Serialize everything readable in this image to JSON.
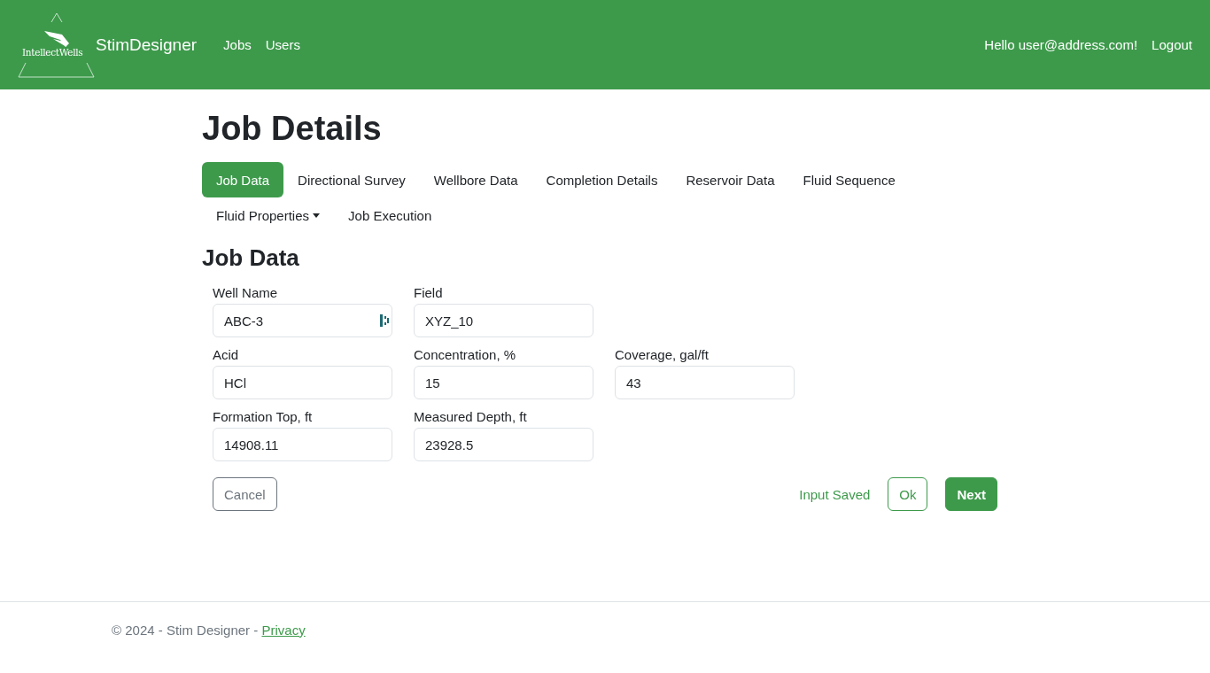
{
  "header": {
    "logo_text": "IntellectWells",
    "brand": "StimDesigner",
    "nav": [
      "Jobs",
      "Users"
    ],
    "greeting": "Hello user@address.com!",
    "logout": "Logout"
  },
  "page_title": "Job Details",
  "tabs": [
    {
      "label": "Job Data",
      "selected": true,
      "dropdown": false
    },
    {
      "label": "Directional Survey",
      "selected": false,
      "dropdown": false
    },
    {
      "label": "Wellbore Data",
      "selected": false,
      "dropdown": false
    },
    {
      "label": "Completion Details",
      "selected": false,
      "dropdown": false
    },
    {
      "label": "Reservoir Data",
      "selected": false,
      "dropdown": false
    },
    {
      "label": "Fluid Sequence",
      "selected": false,
      "dropdown": false
    },
    {
      "label": "Fluid Properties",
      "selected": false,
      "dropdown": true
    },
    {
      "label": "Job Execution",
      "selected": false,
      "dropdown": false
    }
  ],
  "section_title": "Job Data",
  "form_rows": [
    [
      {
        "label": "Well Name",
        "value": "ABC-3",
        "autofill_icon": true
      },
      {
        "label": "Field",
        "value": "XYZ_10",
        "autofill_icon": false
      }
    ],
    [
      {
        "label": "Acid",
        "value": "HCl",
        "autofill_icon": false
      },
      {
        "label": "Concentration, %",
        "value": "15",
        "autofill_icon": false
      },
      {
        "label": "Coverage, gal/ft",
        "value": "43",
        "autofill_icon": false
      }
    ],
    [
      {
        "label": "Formation Top, ft",
        "value": "14908.11",
        "autofill_icon": false
      },
      {
        "label": "Measured Depth, ft",
        "value": "23928.5",
        "autofill_icon": false
      }
    ]
  ],
  "actions": {
    "cancel": "Cancel",
    "status": "Input Saved",
    "ok": "Ok",
    "next": "Next"
  },
  "footer": {
    "text": "© 2024 - Stim Designer - ",
    "link": "Privacy"
  }
}
